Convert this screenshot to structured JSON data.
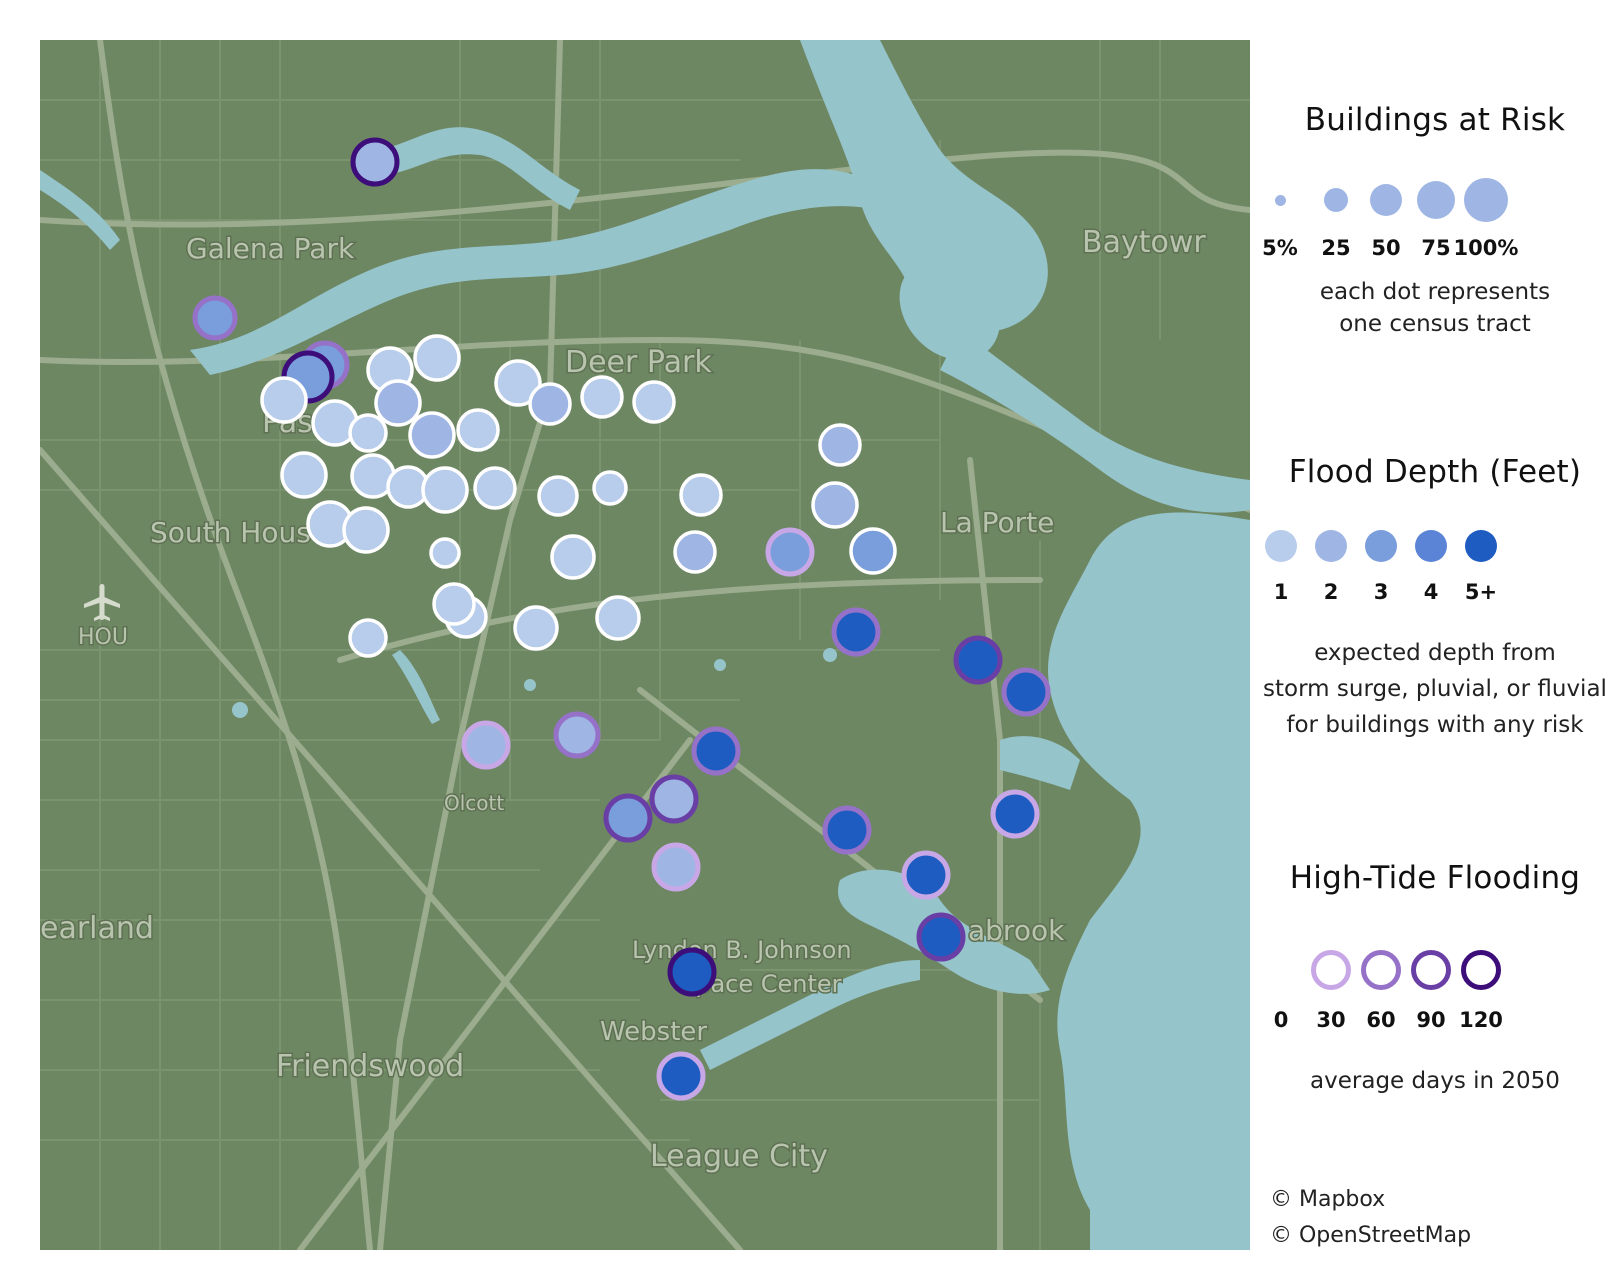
{
  "map": {
    "colors": {
      "land": "#6e8763",
      "water": "#96c4cb",
      "road": "#8ea382",
      "major_road": "#a6b598"
    },
    "labels": {
      "galena_park": "Galena Park",
      "baytown": "Baytowr",
      "deer_park": "Deer Park",
      "pasadena": "Pas",
      "la_porte": "La Porte",
      "south_houston": "South Hous",
      "hou": "HOU",
      "olcott": "Olcott",
      "pearland": "earland",
      "seabrook": "abrook",
      "lbj_line1": "Lyndon B. Johnson",
      "lbj_line2": "Space Center",
      "webster": "Webster",
      "friendswood": "Friendswood",
      "league_city": "League City"
    },
    "airport_icon": "airplane-icon"
  },
  "legend": {
    "buildings": {
      "title": "Buildings at Risk",
      "sizes": [
        "5%",
        "25",
        "50",
        "75",
        "100%"
      ],
      "caption_line1": "each dot represents",
      "caption_line2": "one census tract"
    },
    "depth": {
      "title": "Flood Depth (Feet)",
      "labels": [
        "1",
        "2",
        "3",
        "4",
        "5+"
      ],
      "colors": [
        "#b8cceb",
        "#9fb6e5",
        "#7a9ddc",
        "#5b84d6",
        "#1f5cc2"
      ],
      "caption_line1": "expected depth from",
      "caption_line2": "storm surge, pluvial, or fluvial",
      "caption_line3": "for buildings with any risk"
    },
    "tide": {
      "title": "High-Tide Flooding",
      "labels": [
        "0",
        "30",
        "60",
        "90",
        "120"
      ],
      "colors": [
        "#ffffff",
        "#c7a7e6",
        "#9571c8",
        "#6a3fa5",
        "#3d0d7a"
      ],
      "caption": "average days in 2050"
    }
  },
  "attribution": {
    "mapbox": "© Mapbox",
    "osm": "© OpenStreetMap"
  }
}
